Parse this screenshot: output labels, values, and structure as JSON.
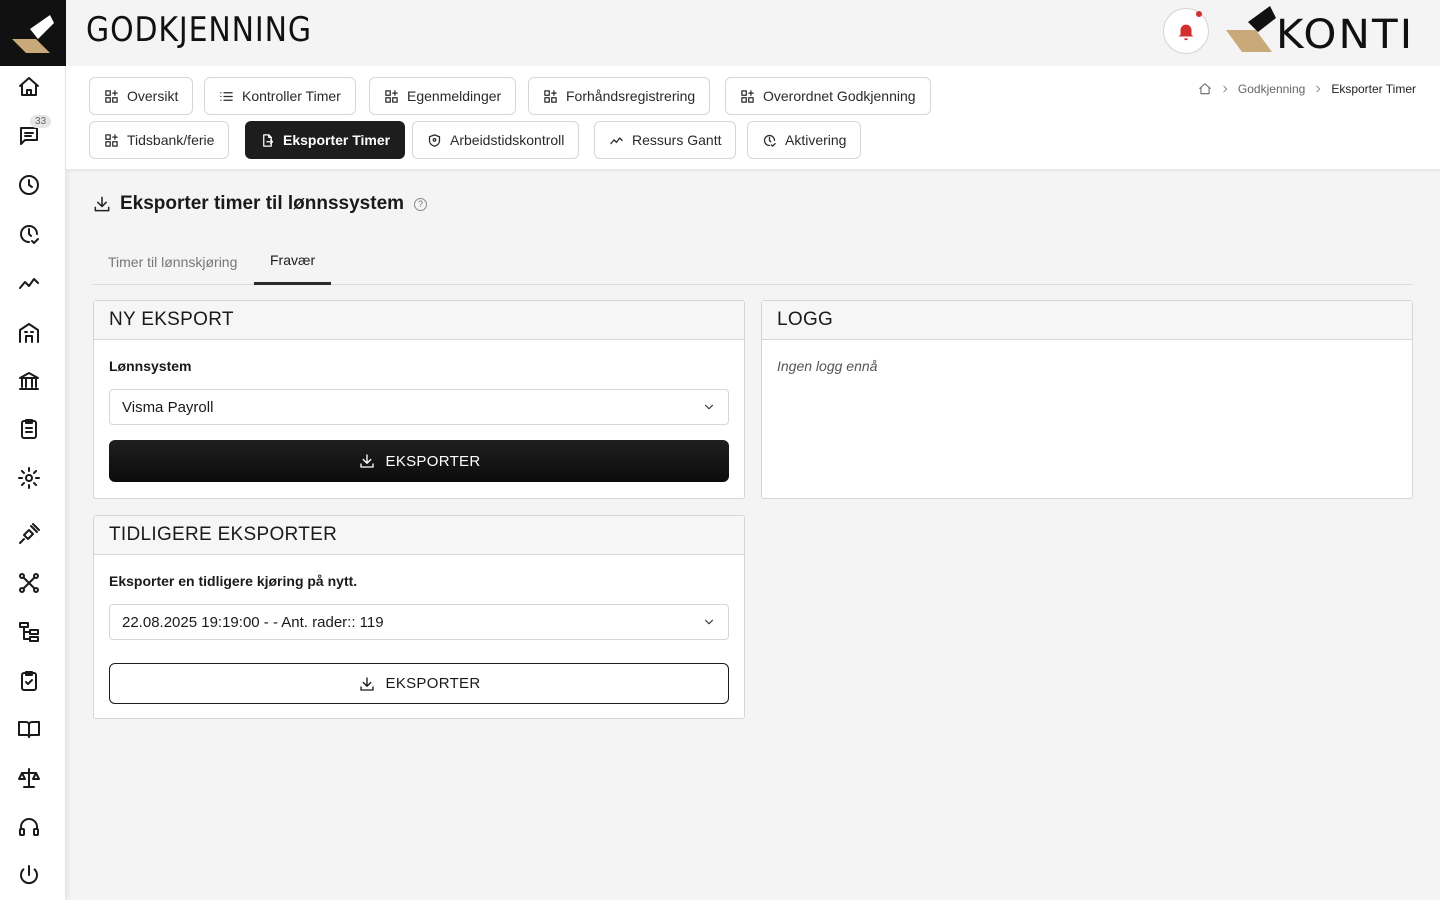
{
  "header": {
    "title": "GODKJENNING",
    "brand": "KONTI"
  },
  "sidebar": {
    "badge_count": "33"
  },
  "nav_tabs": [
    {
      "label": "Oversikt",
      "icon": "grid-icon"
    },
    {
      "label": "Kontroller Timer",
      "icon": "list-icon"
    },
    {
      "label": "Egenmeldinger",
      "icon": "grid-icon"
    },
    {
      "label": "Forhåndsregistrering",
      "icon": "grid-icon"
    },
    {
      "label": "Overordnet Godkjenning",
      "icon": "grid-icon"
    },
    {
      "label": "Tidsbank/ferie",
      "icon": "grid-icon"
    },
    {
      "label": "Eksporter Timer",
      "icon": "file-export-icon",
      "active": true
    },
    {
      "label": "Arbeidstidskontroll",
      "icon": "shield-icon"
    },
    {
      "label": "Ressurs Gantt",
      "icon": "trend-icon"
    },
    {
      "label": "Aktivering",
      "icon": "clock-check-icon"
    }
  ],
  "breadcrumb": {
    "items": [
      "Godkjenning",
      "Eksporter Timer"
    ]
  },
  "content": {
    "title": "Eksporter timer til lønnssystem",
    "help": "?",
    "subtabs": [
      "Timer til lønnskjøring",
      "Fravær"
    ],
    "active_subtab": "Fravær"
  },
  "ny_eksport": {
    "title": "NY EKSPORT",
    "label": "Lønnsystem",
    "selected": "Visma Payroll",
    "button": "EKSPORTER"
  },
  "logg": {
    "title": "LOGG",
    "empty": "Ingen logg ennå"
  },
  "tidligere": {
    "title": "TIDLIGERE EKSPORTER",
    "label": "Eksporter en tidligere kjøring på nytt.",
    "selected": "22.08.2025 19:19:00 - - Ant. rader:: 119",
    "button": "EKSPORTER"
  },
  "colors": {
    "accent": "#1d1d1d",
    "brand_gold": "#c9a97a",
    "notification": "#d32f2f"
  }
}
